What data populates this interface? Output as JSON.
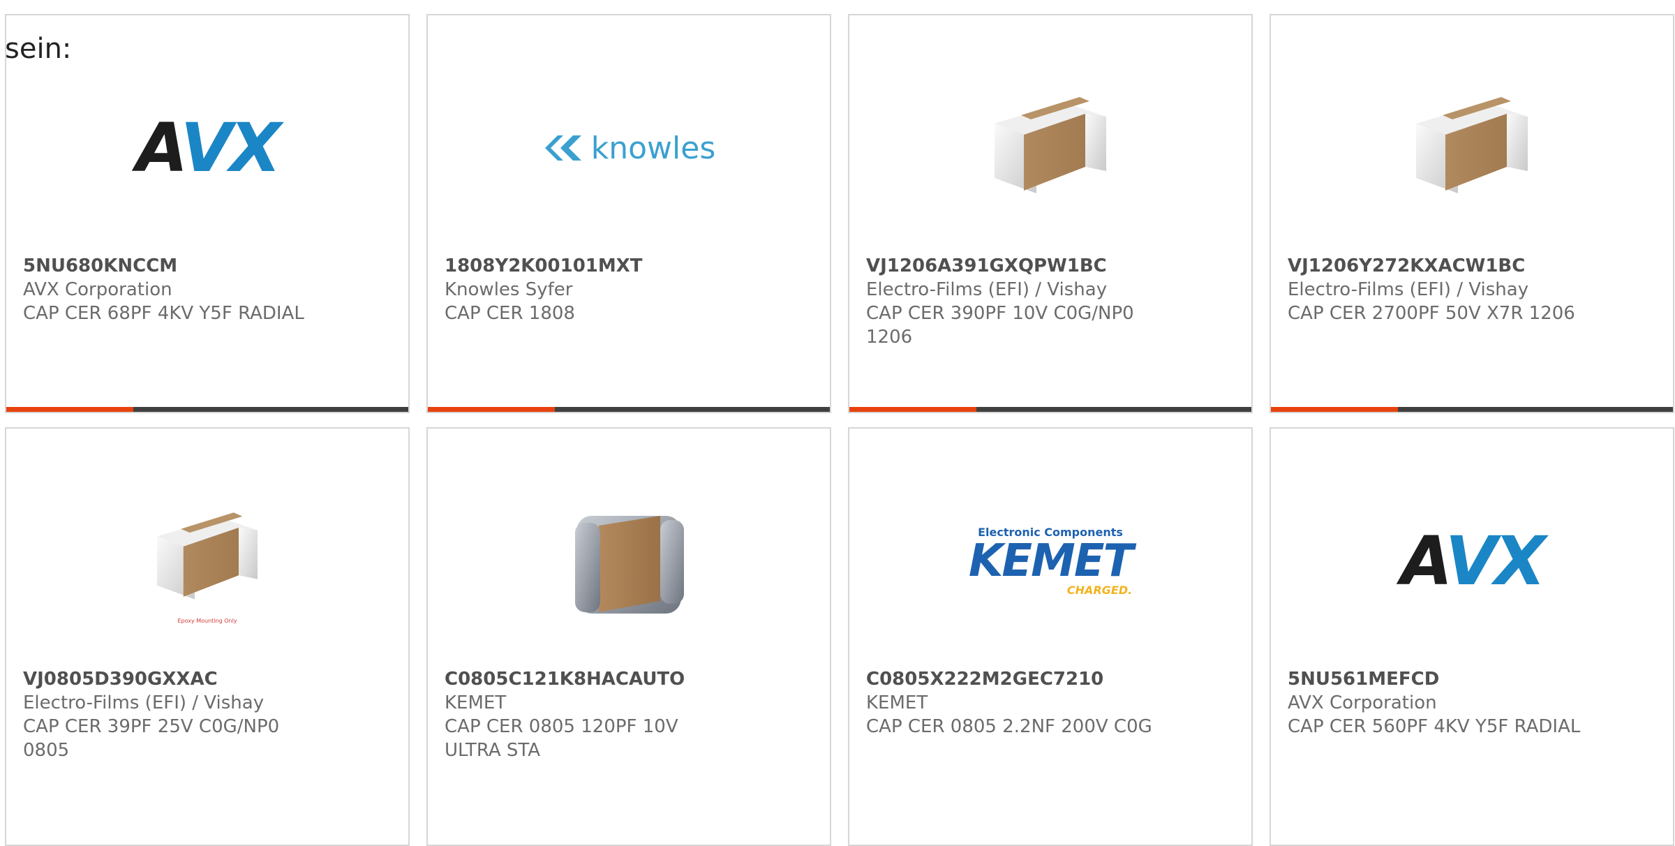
{
  "lead_text": "sein:",
  "colors": {
    "accent": "#e8420f",
    "bar": "#404040",
    "border": "#d6d6d6"
  },
  "cards": [
    {
      "part_number": "5NU680KNCCM",
      "manufacturer": "AVX Corporation",
      "description": "CAP CER 68PF 4KV Y5F RADIAL",
      "image": "avx-logo"
    },
    {
      "part_number": "1808Y2K00101MXT",
      "manufacturer": "Knowles Syfer",
      "description": "CAP CER 1808",
      "image": "knowles-logo",
      "logo_text": "knowles"
    },
    {
      "part_number": "VJ1206A391GXQPW1BC",
      "manufacturer": "Electro-Films (EFI) / Vishay",
      "description": "CAP CER 390PF 10V C0G/NP0 1206",
      "image": "capacitor-chip"
    },
    {
      "part_number": "VJ1206Y272KXACW1BC",
      "manufacturer": "Electro-Films (EFI) / Vishay",
      "description": "CAP CER 2700PF 50V X7R 1206",
      "image": "capacitor-chip"
    },
    {
      "part_number": "VJ0805D390GXXAC",
      "manufacturer": "Electro-Films (EFI) / Vishay",
      "description": "CAP CER 39PF 25V C0G/NP0 0805",
      "image": "capacitor-chip-epoxy",
      "image_note": "Epoxy Mounting Only"
    },
    {
      "part_number": "C0805C121K8HACAUTO",
      "manufacturer": "KEMET",
      "description": "CAP CER 0805 120PF 10V ULTRA STA",
      "image": "capacitor-chip-metal"
    },
    {
      "part_number": "C0805X222M2GEC7210",
      "manufacturer": "KEMET",
      "description": "CAP CER 0805 2.2NF 200V C0G",
      "image": "kemet-logo",
      "logo_top": "Electronic Components",
      "logo_main": "KEMET",
      "logo_sub": "CHARGED."
    },
    {
      "part_number": "5NU561MEFCD",
      "manufacturer": "AVX Corporation",
      "description": "CAP CER 560PF 4KV Y5F RADIAL",
      "image": "avx-logo"
    }
  ]
}
